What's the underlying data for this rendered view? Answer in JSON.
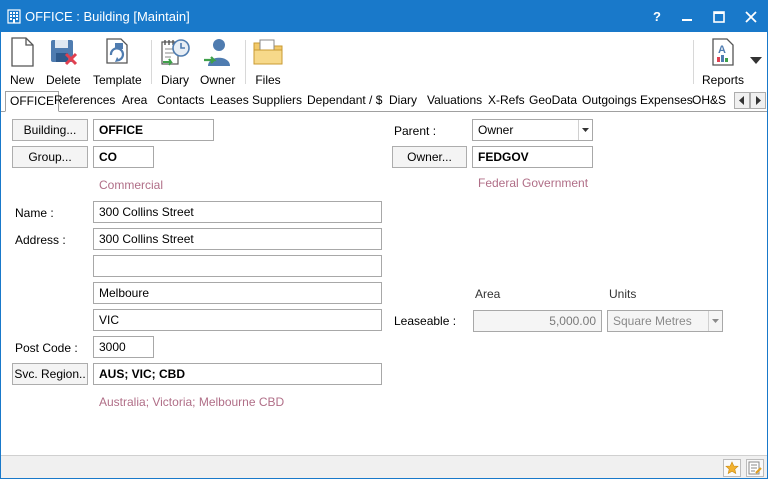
{
  "window": {
    "title": "OFFICE : Building [Maintain]"
  },
  "title_buttons": {
    "help": "?",
    "minimize": "—",
    "maximize": "□",
    "close": "✕"
  },
  "toolbar": {
    "new": "New",
    "delete": "Delete",
    "template": "Template",
    "diary": "Diary",
    "owner": "Owner",
    "files": "Files",
    "reports": "Reports"
  },
  "tabs": [
    "OFFICE",
    "References",
    "Area",
    "Contacts",
    "Leases",
    "Suppliers",
    "Dependant / $",
    "Diary",
    "Valuations",
    "X-Refs",
    "GeoData",
    "Outgoings Expenses",
    "OH&S"
  ],
  "form": {
    "building_button": "Building...",
    "building_value": "OFFICE",
    "group_button": "Group...",
    "group_value": "CO",
    "group_desc": "Commercial",
    "name_label": "Name :",
    "name_value": "300 Collins Street",
    "address_label": "Address :",
    "address_line1": "300 Collins Street",
    "address_line2": "",
    "address_line3": "Melboure",
    "address_line4": "VIC",
    "postcode_label": "Post Code :",
    "postcode_value": "3000",
    "svc_region_button": "Svc. Region..",
    "svc_region_value": "AUS; VIC; CBD",
    "svc_region_desc": "Australia; Victoria; Melbourne CBD",
    "parent_label": "Parent :",
    "parent_value": "Owner",
    "owner_button": "Owner...",
    "owner_value": "FEDGOV",
    "owner_desc": "Federal Government",
    "area_header": "Area",
    "units_header": "Units",
    "leaseable_label": "Leaseable :",
    "leaseable_value": "5,000.00",
    "units_value": "Square Metres"
  }
}
